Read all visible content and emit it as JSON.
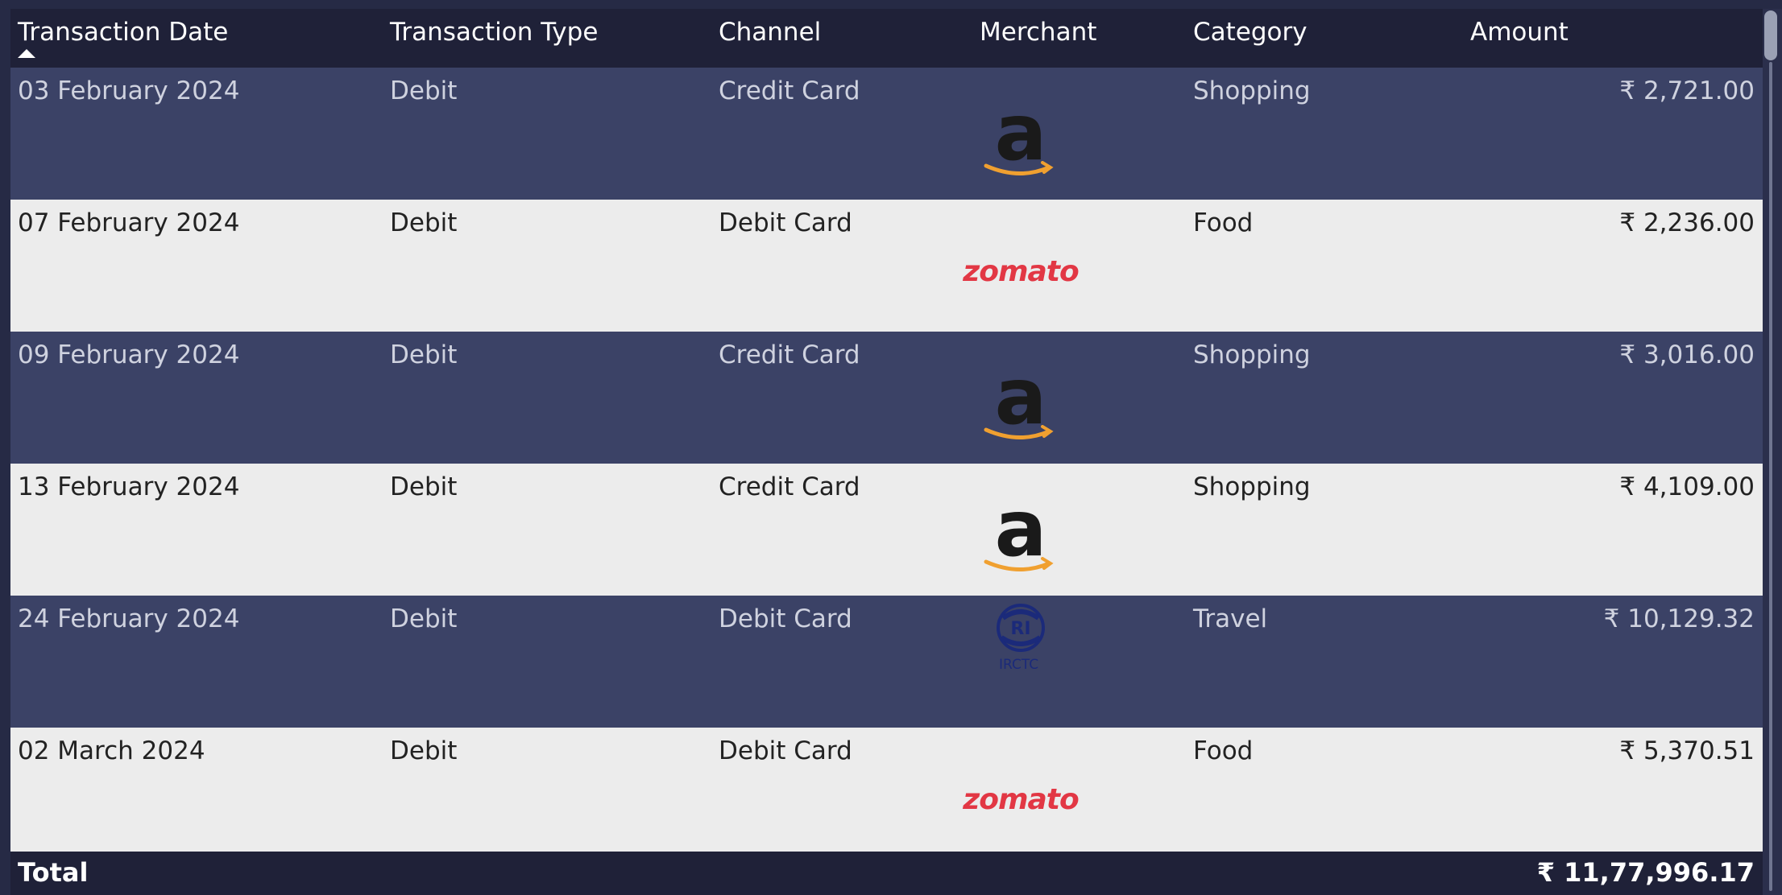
{
  "table": {
    "columns": [
      {
        "label": "Transaction Date"
      },
      {
        "label": "Transaction Type"
      },
      {
        "label": "Channel"
      },
      {
        "label": "Merchant"
      },
      {
        "label": "Category"
      },
      {
        "label": "Amount"
      }
    ],
    "sort": {
      "column": "Transaction Date",
      "direction": "ascending",
      "icon": "sort-ascending-icon"
    },
    "rows": [
      {
        "date": "03 February 2024",
        "type": "Debit",
        "channel": "Credit Card",
        "merchant_logo": "amazon-logo",
        "category": "Shopping",
        "amount": "₹ 2,721.00"
      },
      {
        "date": "07 February 2024",
        "type": "Debit",
        "channel": "Debit Card",
        "merchant_logo": "zomato-logo",
        "merchant_text": "zomato",
        "category": "Food",
        "amount": "₹ 2,236.00"
      },
      {
        "date": "09 February 2024",
        "type": "Debit",
        "channel": "Credit Card",
        "merchant_logo": "amazon-logo",
        "category": "Shopping",
        "amount": "₹ 3,016.00"
      },
      {
        "date": "13 February 2024",
        "type": "Debit",
        "channel": "Credit Card",
        "merchant_logo": "amazon-logo",
        "category": "Shopping",
        "amount": "₹ 4,109.00"
      },
      {
        "date": "24 February 2024",
        "type": "Debit",
        "channel": "Debit Card",
        "merchant_logo": "irctc-logo",
        "merchant_text": "IRCTC",
        "category": "Travel",
        "amount": "₹ 10,129.32"
      },
      {
        "date": "02 March 2024",
        "type": "Debit",
        "channel": "Debit Card",
        "merchant_logo": "zomato-logo",
        "merchant_text": "zomato",
        "category": "Food",
        "amount": "₹ 5,370.51"
      }
    ],
    "total": {
      "label": "Total",
      "amount": "₹ 11,77,996.17"
    }
  },
  "colors": {
    "header_bg": "#1f2138",
    "row_dark": "#3b4266",
    "row_light": "#ececec",
    "zomato_red": "#e23744",
    "amazon_orange": "#f0a030",
    "irctc_blue": "#1b2a7a"
  }
}
